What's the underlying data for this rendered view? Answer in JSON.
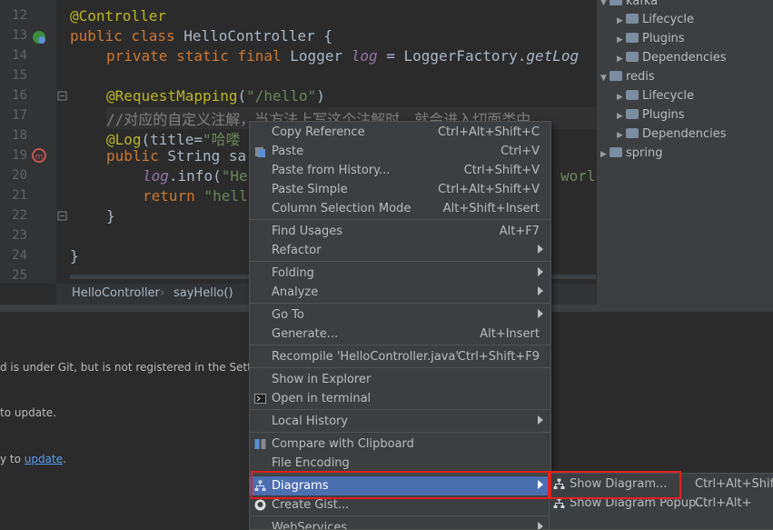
{
  "editor": {
    "line_numbers": [
      "12",
      "13",
      "14",
      "15",
      "16",
      "17",
      "18",
      "19",
      "20",
      "21",
      "22",
      "23",
      "24",
      "25"
    ],
    "code": {
      "l12": "@Controller",
      "l13_kw": "public class",
      "l13_rest": " HelloController {",
      "l14_kw": "private static final",
      "l14_type": " Logger ",
      "l14_field": "log",
      "l14_rest": " = LoggerFactory.",
      "l14_call": "getLog",
      "l16_ann": "@RequestMapping",
      "l16_open": "(",
      "l16_str": "\"/hello\"",
      "l16_close": ")",
      "l17": "//对应的自定义注解，当方法上写这个注解时，就会进入切面类中",
      "l18_ann": "@Log",
      "l18_rest": "(title=",
      "l18_str": "\"哈喽",
      "l19_kw": "public",
      "l19_rest": " String sa",
      "l20_field": "log",
      "l20_rest": ".info(",
      "l20_str": "\"He",
      "l20_tail": "worl",
      "l21_kw": "return",
      "l21_str": " \"hell",
      "l22": "}",
      "l24": "}"
    },
    "breadcrumb": [
      "HelloController",
      "sayHello()"
    ]
  },
  "tree": {
    "items": [
      {
        "label": "kafka",
        "level": 0,
        "expanded": true
      },
      {
        "label": "Lifecycle",
        "level": 1
      },
      {
        "label": "Plugins",
        "level": 1
      },
      {
        "label": "Dependencies",
        "level": 1
      },
      {
        "label": "redis",
        "level": 0,
        "expanded": true
      },
      {
        "label": "Lifecycle",
        "level": 1
      },
      {
        "label": "Plugins",
        "level": 1
      },
      {
        "label": "Dependencies",
        "level": 1
      },
      {
        "label": "spring",
        "level": 0,
        "expanded": false
      }
    ]
  },
  "bottom": {
    "line1": "d is under Git, but is not registered in the Settin",
    "line2_prefix": "to ",
    "line2_link": "update",
    "line2_suffix": ".",
    "line3_prefix": "y to ",
    "line3_link": "update",
    "line3_suffix": "."
  },
  "menu": {
    "items": [
      {
        "label": "Copy Reference",
        "shortcut": "Ctrl+Alt+Shift+C"
      },
      {
        "label": "Paste",
        "shortcut": "Ctrl+V",
        "icon": "paste-icon"
      },
      {
        "label": "Paste from History...",
        "shortcut": "Ctrl+Shift+V"
      },
      {
        "label": "Paste Simple",
        "shortcut": "Ctrl+Alt+Shift+V"
      },
      {
        "label": "Column Selection Mode",
        "shortcut": "Alt+Shift+Insert"
      },
      {
        "label": "Find Usages",
        "shortcut": "Alt+F7"
      },
      {
        "label": "Refactor",
        "submenu": true
      },
      {
        "label": "Folding",
        "submenu": true
      },
      {
        "label": "Analyze",
        "submenu": true
      },
      {
        "label": "Go To",
        "submenu": true
      },
      {
        "label": "Generate...",
        "shortcut": "Alt+Insert"
      },
      {
        "label": "Recompile 'HelloController.java'",
        "shortcut": "Ctrl+Shift+F9"
      },
      {
        "label": "Show in Explorer"
      },
      {
        "label": "Open in terminal",
        "icon": "terminal-icon"
      },
      {
        "label": "Local History",
        "submenu": true
      },
      {
        "label": "Compare with Clipboard",
        "icon": "compare-icon"
      },
      {
        "label": "File Encoding"
      },
      {
        "label": "Diagrams",
        "submenu": true,
        "icon": "diagram-icon",
        "highlighted": true
      },
      {
        "label": "Create Gist...",
        "icon": "github-icon"
      },
      {
        "label": "WebServices",
        "submenu": true
      }
    ]
  },
  "submenu": {
    "items": [
      {
        "label": "Show Diagram...",
        "shortcut": "Ctrl+Alt+Shift+",
        "icon": "diagram-icon"
      },
      {
        "label": "Show Diagram Popup...",
        "shortcut": "Ctrl+Alt+",
        "icon": "diagram-icon"
      }
    ]
  },
  "colors": {
    "highlight": "#4b6eaf",
    "annotation_box": "#e02020",
    "menu_bg": "#3c3f41"
  }
}
